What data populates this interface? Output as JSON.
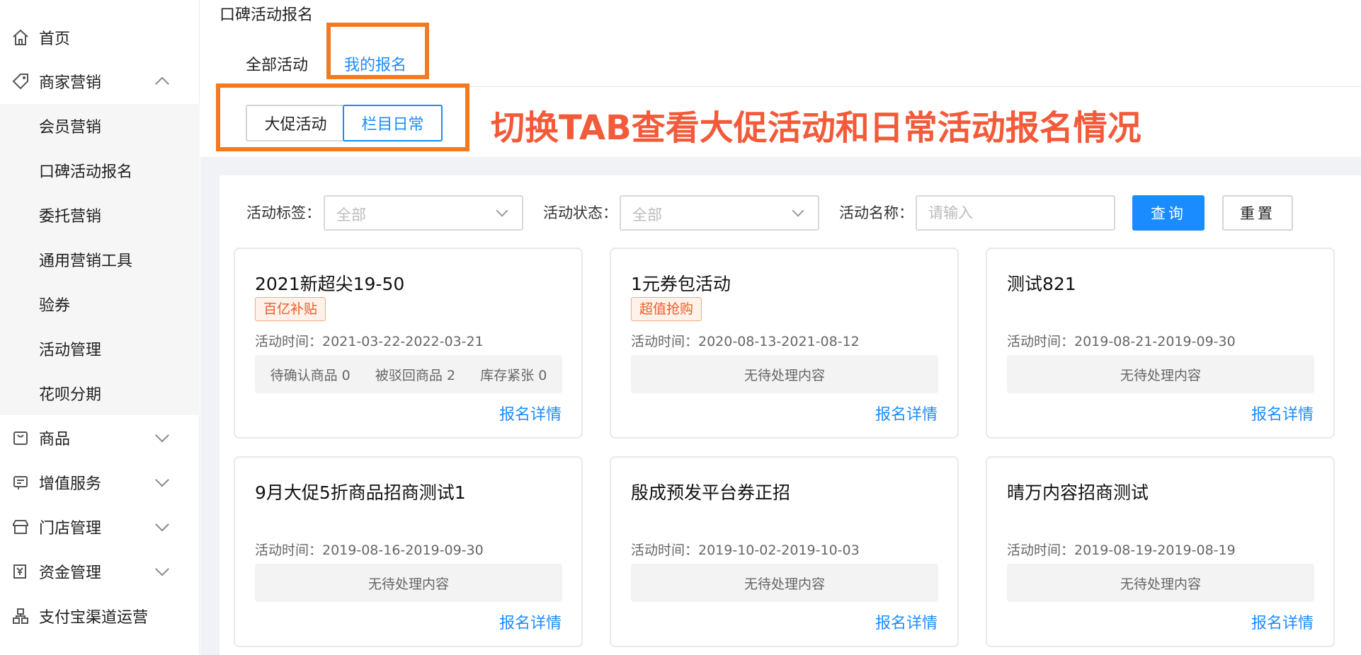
{
  "sidebar": {
    "items": [
      {
        "label": "首页",
        "icon": "home-icon"
      },
      {
        "label": "商家营销",
        "icon": "tag-icon",
        "expanded": true
      },
      {
        "label": "商品",
        "icon": "bag-icon"
      },
      {
        "label": "增值服务",
        "icon": "service-icon"
      },
      {
        "label": "门店管理",
        "icon": "store-icon"
      },
      {
        "label": "资金管理",
        "icon": "fund-icon"
      },
      {
        "label": "支付宝渠道运营",
        "icon": "channel-icon"
      }
    ],
    "sub_items": [
      "会员营销",
      "口碑活动报名",
      "委托营销",
      "通用营销工具",
      "验券",
      "活动管理",
      "花呗分期"
    ]
  },
  "page_title": "口碑活动报名",
  "tabs": [
    {
      "label": "全部活动",
      "active": false
    },
    {
      "label": "我的报名",
      "active": true
    }
  ],
  "segment": [
    {
      "label": "大促活动",
      "active": false
    },
    {
      "label": "栏目日常",
      "active": true
    }
  ],
  "annotation": "切换TAB查看大促活动和日常活动报名情况",
  "filters": {
    "tag_label": "活动标签：",
    "tag_value": "全部",
    "status_label": "活动状态：",
    "status_value": "全部",
    "name_label": "活动名称：",
    "name_placeholder": "请输入",
    "search_button": "查询",
    "reset_button": "重置"
  },
  "cards": [
    {
      "title": "2021新超尖19-50",
      "tag": "百亿补贴",
      "time": "活动时间：2021-03-22-2022-03-21",
      "stats": [
        "待确认商品 0",
        "被驳回商品 2",
        "库存紧张 0"
      ],
      "empty": "",
      "link": "报名详情"
    },
    {
      "title": "1元券包活动",
      "tag": "超值抢购",
      "time": "活动时间：2020-08-13-2021-08-12",
      "stats": [],
      "empty": "无待处理内容",
      "link": "报名详情"
    },
    {
      "title": "测试821",
      "tag": "",
      "time": "活动时间：2019-08-21-2019-09-30",
      "stats": [],
      "empty": "无待处理内容",
      "link": "报名详情"
    },
    {
      "title": "9月大促5折商品招商测试1",
      "tag": "",
      "time": "活动时间：2019-08-16-2019-09-30",
      "stats": [],
      "empty": "无待处理内容",
      "link": "报名详情"
    },
    {
      "title": "殷成预发平台券正招",
      "tag": "",
      "time": "活动时间：2019-10-02-2019-10-03",
      "stats": [],
      "empty": "无待处理内容",
      "link": "报名详情"
    },
    {
      "title": "晴万内容招商测试",
      "tag": "",
      "time": "活动时间：2019-08-19-2019-08-19",
      "stats": [],
      "empty": "无待处理内容",
      "link": "报名详情"
    }
  ],
  "colors": {
    "primary": "#1a8cff",
    "highlight": "#f47a20",
    "annotation": "#f25a3a",
    "tag": "#f05a28"
  }
}
